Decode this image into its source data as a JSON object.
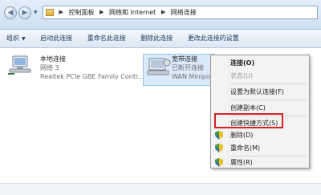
{
  "address_bar": {
    "crumbs": [
      "控制面板",
      "网络和 Internet",
      "网络连接"
    ]
  },
  "toolbar": {
    "items": [
      "组织",
      "启动此连接",
      "重命名此连接",
      "删除此连接",
      "更改此连接的设置"
    ]
  },
  "connections": [
    {
      "name": "本地连接",
      "status": "网络  3",
      "device": "Realtek PCIe GBE Family Contr..."
    },
    {
      "name": "宽带连接",
      "status": "已断开连接",
      "device": "WAN Minipo"
    }
  ],
  "context_menu": {
    "items": [
      "连接(O)",
      "状态(U)",
      "设置为默认连接(F)",
      "创建副本(C)",
      "创建快捷方式(S)",
      "删除(D)",
      "重命名(M)",
      "属性(R)"
    ]
  },
  "colors": {
    "highlight_border": "#d6232a"
  }
}
